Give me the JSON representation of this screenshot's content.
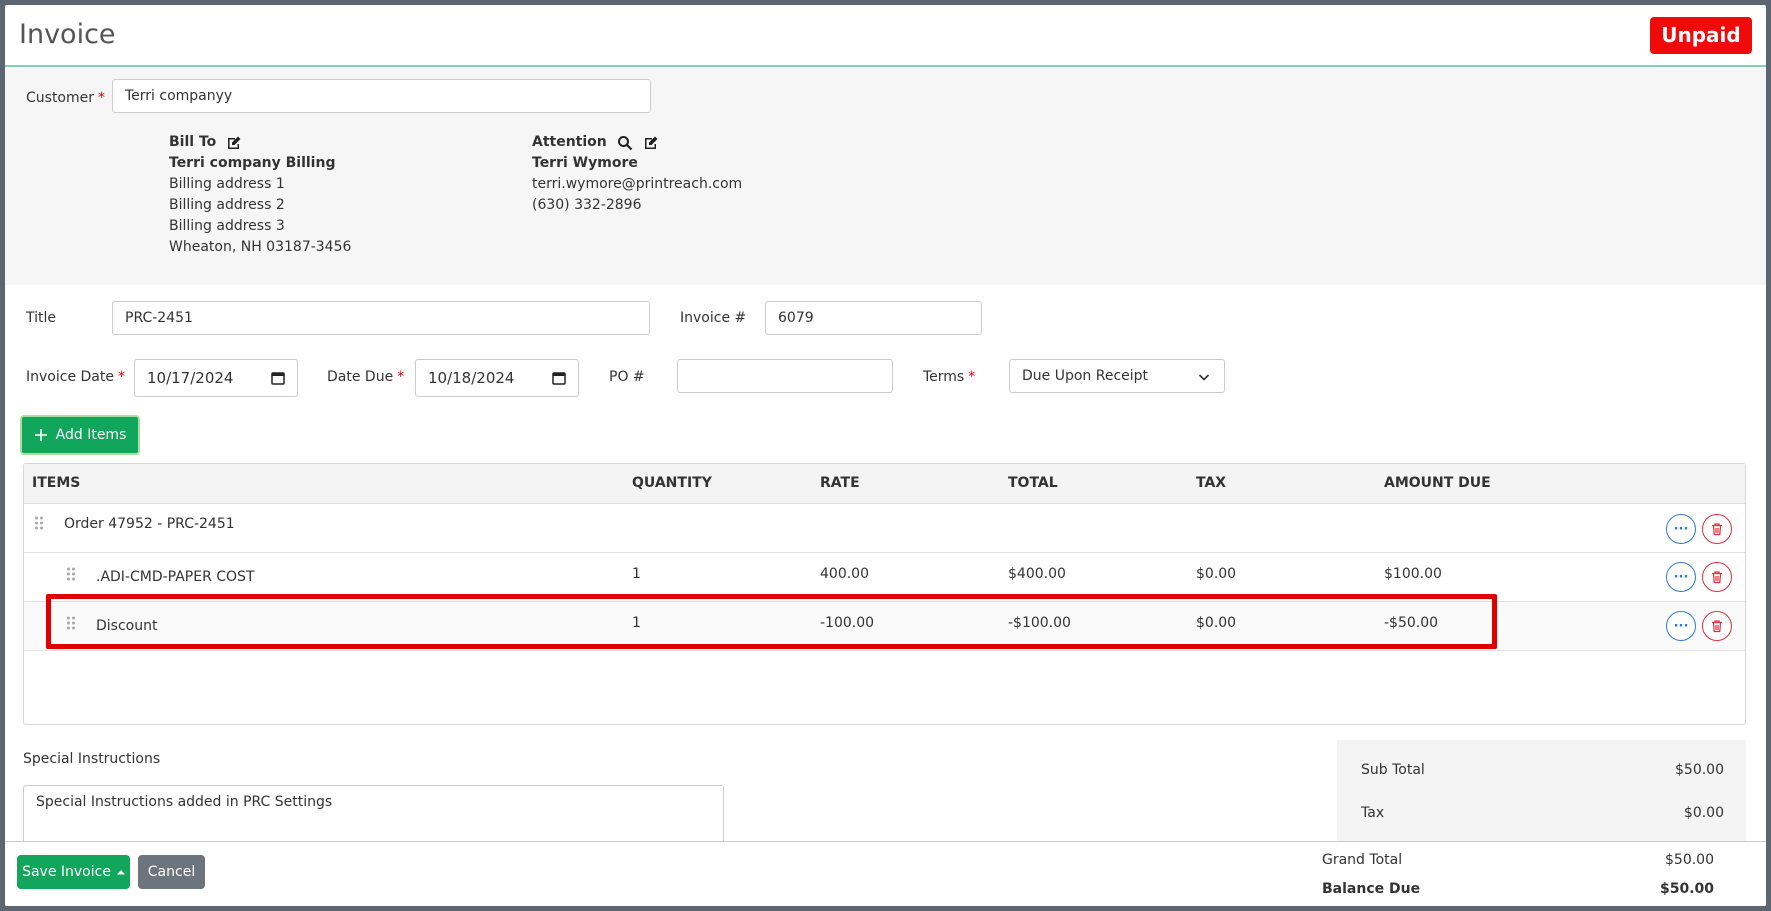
{
  "header": {
    "title": "Invoice",
    "status": "Unpaid"
  },
  "customer": {
    "label": "Customer",
    "value": "Terri companyy"
  },
  "bill_to": {
    "heading": "Bill To",
    "name": "Terri company Billing",
    "lines": [
      "Billing address 1",
      "Billing address 2",
      "Billing address 3",
      "Wheaton, NH 03187-3456"
    ]
  },
  "attention": {
    "heading": "Attention",
    "name": "Terri Wymore",
    "email": "terri.wymore@printreach.com",
    "phone": "(630) 332-2896"
  },
  "fields": {
    "title_label": "Title",
    "title_value": "PRC-2451",
    "invoice_no_label": "Invoice #",
    "invoice_no_value": "6079",
    "invoice_date_label": "Invoice Date",
    "invoice_date_value": "10/17/2024",
    "date_due_label": "Date Due",
    "date_due_value": "10/18/2024",
    "po_label": "PO #",
    "po_value": "",
    "terms_label": "Terms",
    "terms_value": "Due Upon Receipt"
  },
  "add_items_label": "Add Items",
  "table": {
    "columns": [
      "ITEMS",
      "QUANTITY",
      "RATE",
      "TOTAL",
      "TAX",
      "AMOUNT DUE"
    ],
    "rows": [
      {
        "item": "Order 47952 - PRC-2451",
        "quantity": "",
        "rate": "",
        "total": "",
        "tax": "",
        "amount_due": ""
      },
      {
        "item": ".ADI-CMD-PAPER COST",
        "quantity": "1",
        "rate": "400.00",
        "total": "$400.00",
        "tax": "$0.00",
        "amount_due": "$100.00"
      },
      {
        "item": "Discount",
        "quantity": "1",
        "rate": "-100.00",
        "total": "-$100.00",
        "tax": "$0.00",
        "amount_due": "-$50.00"
      }
    ],
    "more_glyph": "···"
  },
  "special_instructions": {
    "label": "Special Instructions",
    "value": "Special Instructions added in PRC Settings"
  },
  "totals": {
    "sub_total_label": "Sub Total",
    "sub_total": "$50.00",
    "tax_label": "Tax",
    "tax": "$0.00",
    "grand_total_label": "Grand Total",
    "grand_total": "$50.00",
    "balance_due_label": "Balance Due",
    "balance_due": "$50.00"
  },
  "footer": {
    "save_label": "Save Invoice",
    "cancel_label": "Cancel"
  },
  "colors": {
    "status": "#f10a0a",
    "primary_green": "#12a55c",
    "highlight": "#e00000"
  },
  "icons": [
    "edit-icon",
    "search-icon",
    "calendar-icon",
    "chevron-down-icon",
    "plus-icon",
    "drag-handle-icon",
    "more-icon",
    "trash-icon",
    "caret-up-icon"
  ]
}
